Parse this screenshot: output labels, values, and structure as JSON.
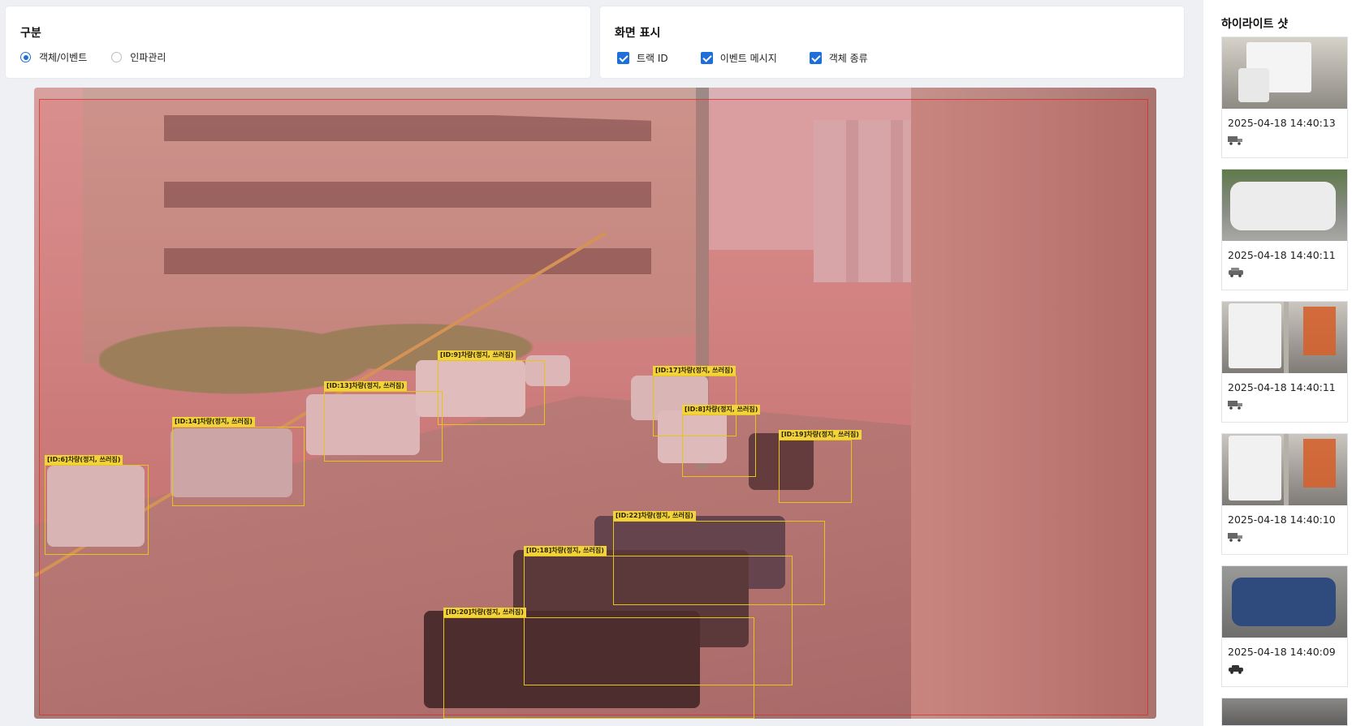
{
  "category_panel": {
    "title": "구분",
    "options": [
      {
        "label": "객체/이벤트",
        "selected": true
      },
      {
        "label": "인파관리",
        "selected": false
      }
    ]
  },
  "display_panel": {
    "title": "화면 표시",
    "checkboxes": [
      {
        "label": "트랙 ID",
        "checked": true
      },
      {
        "label": "이벤트 메시지",
        "checked": true
      },
      {
        "label": "객체 종류",
        "checked": true
      }
    ]
  },
  "detections": [
    {
      "id": "9",
      "label": "[ID:9]차량(정지, 쓰러짐)"
    },
    {
      "id": "13",
      "label": "[ID:13]차량(정지, 쓰러짐)"
    },
    {
      "id": "14",
      "label": "[ID:14]차량(정지, 쓰러짐)"
    },
    {
      "id": "6",
      "label": "[ID:6]차량(정지, 쓰러짐)"
    },
    {
      "id": "17",
      "label": "[ID:17]차량(정지, 쓰러짐)"
    },
    {
      "id": "8",
      "label": "[ID:8]차량(정지, 쓰러짐)"
    },
    {
      "id": "19",
      "label": "[ID:19]차량(정지, 쓰러짐)"
    },
    {
      "id": "22",
      "label": "[ID:22]차량(정지, 쓰러짐)"
    },
    {
      "id": "18",
      "label": "[ID:18]차량(정지, 쓰러짐)"
    },
    {
      "id": "20",
      "label": "[ID:20]차량(정지, 쓰러짐)"
    }
  ],
  "sidebar": {
    "title": "하이라이트 샷",
    "shots": [
      {
        "time": "2025-04-18 14:40:13",
        "icon": "truck-icon"
      },
      {
        "time": "2025-04-18 14:40:11",
        "icon": "suv-icon"
      },
      {
        "time": "2025-04-18 14:40:11",
        "icon": "truck-icon"
      },
      {
        "time": "2025-04-18 14:40:10",
        "icon": "truck-icon"
      },
      {
        "time": "2025-04-18 14:40:09",
        "icon": "car-icon"
      }
    ]
  },
  "colors": {
    "accent": "#1e6fd9",
    "detection_box": "#e6c51a",
    "roi_overlay": "#dc4646"
  }
}
